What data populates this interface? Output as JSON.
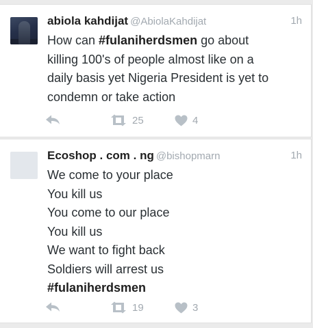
{
  "tweets": [
    {
      "display_name": "abiola kahdijat",
      "screen_name": "@AbiolaKahdijat",
      "time": "1h",
      "avatar": "profile-photo",
      "text_lines": [
        [
          {
            "t": "How can "
          },
          {
            "t": "#fulaniherdsmen",
            "tag": true
          },
          {
            "t": " go about"
          }
        ],
        [
          {
            "t": "killing 100's of people almost like on a"
          }
        ],
        [
          {
            "t": "daily basis yet Nigeria President is yet to"
          }
        ],
        [
          {
            "t": "condemn or take action"
          }
        ]
      ],
      "retweets": "25",
      "likes": "4"
    },
    {
      "display_name": "Ecoshop . com . ng",
      "screen_name": "@bishopmarn",
      "time": "1h",
      "avatar": "default-blank",
      "text_lines": [
        [
          {
            "t": "We come to your place"
          }
        ],
        [
          {
            "t": "You kill us"
          }
        ],
        [
          {
            "t": "You come to our place"
          }
        ],
        [
          {
            "t": "You kill us"
          }
        ],
        [
          {
            "t": "We want to fight back"
          }
        ],
        [
          {
            "t": "Soldiers will arrest us"
          }
        ],
        [
          {
            "t": "#fulaniherdsmen",
            "tag": true
          }
        ]
      ],
      "retweets": "19",
      "likes": "3"
    }
  ],
  "icons": {
    "reply": "reply-icon",
    "retweet": "retweet-icon",
    "like": "heart-icon"
  },
  "colors": {
    "background": "#ebebeb",
    "card": "#ffffff",
    "name": "#1f1f1f",
    "body_text": "#292f33",
    "muted": "#a2a9b0",
    "icon": "#b8c0c7"
  }
}
